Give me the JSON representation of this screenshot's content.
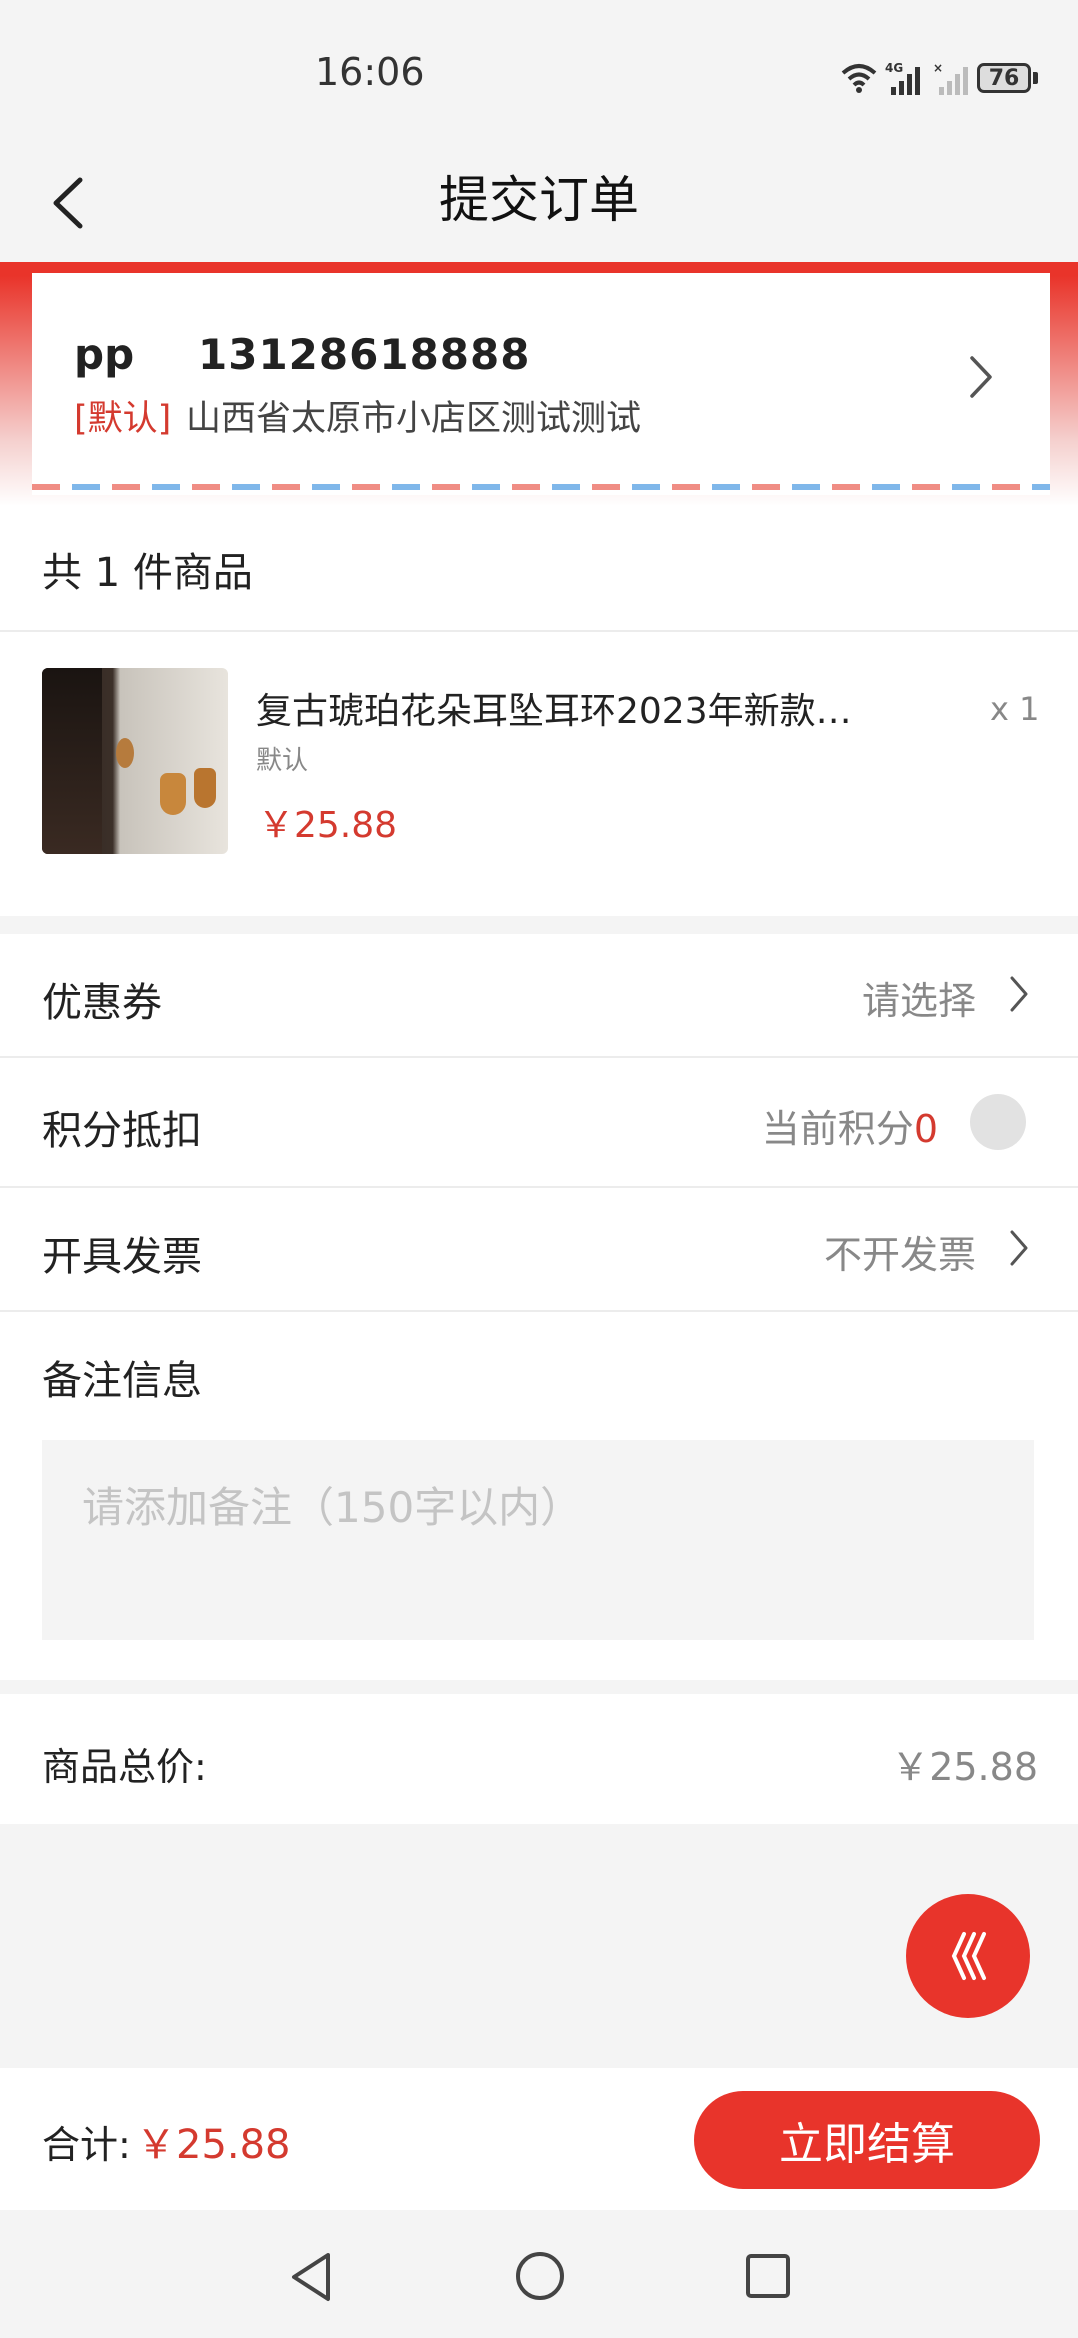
{
  "status_bar": {
    "time": "16:06",
    "battery": "76",
    "network": "4G"
  },
  "header": {
    "title": "提交订单"
  },
  "address": {
    "name": "pp",
    "phone": "13128618888",
    "tag": "[默认]",
    "detail": "山西省太原市小店区测试测试"
  },
  "products": {
    "count_label": "共 1 件商品",
    "items": [
      {
        "title": "复古琥珀花朵耳坠耳环2023年新款…",
        "spec": "默认",
        "price": "￥25.88",
        "qty": "x 1"
      }
    ]
  },
  "options": {
    "coupon": {
      "label": "优惠券",
      "value": "请选择"
    },
    "points": {
      "label": "积分抵扣",
      "value": "当前积分",
      "amount": "0"
    },
    "invoice": {
      "label": "开具发票",
      "value": "不开发票"
    },
    "note": {
      "label": "备注信息",
      "placeholder": "请添加备注（150字以内）"
    }
  },
  "summary": {
    "label": "商品总价:",
    "value": "￥25.88"
  },
  "bottom_bar": {
    "sum_label": "合计:",
    "sum_value": "￥25.88",
    "checkout_label": "立即结算"
  },
  "colors": {
    "accent": "#e8342b",
    "price": "#d43a2f"
  }
}
